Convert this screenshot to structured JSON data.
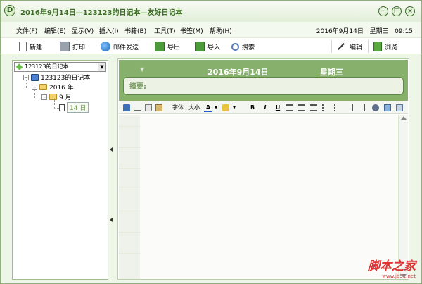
{
  "window": {
    "title": "2016年9月14日—123123的日记本—友好日记本"
  },
  "menu": {
    "items": [
      "文件(F)",
      "编辑(E)",
      "显示(V)",
      "插入(I)",
      "书籍(B)",
      "工具(T)",
      "书签(M)",
      "帮助(H)"
    ],
    "date": "2016年9月14日",
    "weekday": "星期三",
    "time": "09:15"
  },
  "toolbar": {
    "new_label": "新建",
    "print_label": "打印",
    "mail_label": "邮件发送",
    "export_label": "导出",
    "import_label": "导入",
    "search_label": "搜索",
    "edit_label": "编辑",
    "browse_label": "浏览"
  },
  "sidebar": {
    "selected_notebook": "123123的日记本",
    "tree": {
      "notebook": "123123的日记本",
      "year": "2016 年",
      "month": "9 月",
      "day": "14 日"
    }
  },
  "entry": {
    "date": "2016年9月14日",
    "weekday": "星期三",
    "summary_label": "摘要:"
  },
  "format_toolbar": {
    "font_label": "字体",
    "size_label": "大小",
    "color_label": "A",
    "bold": "B",
    "italic": "I",
    "underline": "U"
  },
  "watermark": {
    "main": "脚本之家",
    "sub": "www.jb51.net"
  },
  "colors": {
    "accent": "#87b06c",
    "title_text": "#3c6e25",
    "background": "#eef6e8"
  }
}
